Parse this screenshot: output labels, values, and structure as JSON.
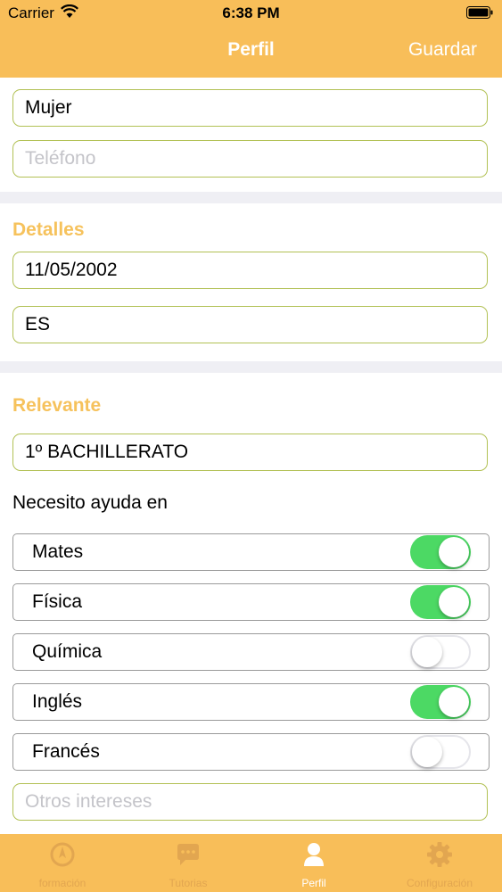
{
  "status_bar": {
    "carrier": "Carrier",
    "time": "6:38 PM"
  },
  "nav": {
    "title": "Perfil",
    "save_label": "Guardar"
  },
  "contact": {
    "gender_value": "Mujer",
    "phone_placeholder": "Teléfono"
  },
  "details": {
    "header": "Detalles",
    "birthdate_value": "11/05/2002",
    "country_value": "ES"
  },
  "relevant": {
    "header": "Relevante",
    "course_value": "1º BACHILLERATO",
    "help_label": "Necesito ayuda en",
    "subjects": [
      {
        "label": "Mates",
        "on": true
      },
      {
        "label": "Física",
        "on": true
      },
      {
        "label": "Química",
        "on": false
      },
      {
        "label": "Inglés",
        "on": true
      },
      {
        "label": "Francés",
        "on": false
      }
    ],
    "other_placeholder": "Otros intereses"
  },
  "tabs": [
    {
      "label": "formación",
      "icon": "compass-icon",
      "active": false
    },
    {
      "label": "Tutorias",
      "icon": "chat-bubble-icon",
      "active": false
    },
    {
      "label": "Perfil",
      "icon": "person-icon",
      "active": true
    },
    {
      "label": "Configuración",
      "icon": "gear-icon",
      "active": false
    }
  ],
  "colors": {
    "accent": "#f8be59",
    "section_header": "#f6c25c",
    "field_border": "#b2c155",
    "switch_on": "#4cd964",
    "background": "#efeff4"
  }
}
